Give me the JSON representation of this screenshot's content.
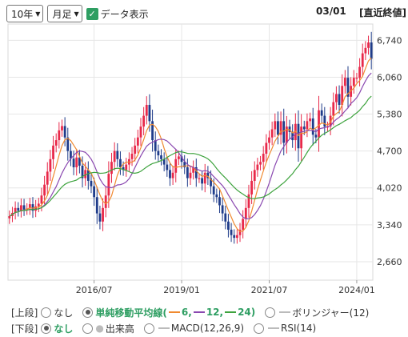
{
  "toolbar": {
    "period": "10年",
    "interval": "月足",
    "data_display_label": "データ表示",
    "date": "03/01",
    "close_label": "[直近終値]"
  },
  "controls": {
    "upper_label": "[上段]",
    "lower_label": "[下段]",
    "none": "なし",
    "sma_label": "単純移動平均線(",
    "sma_6": "6",
    "sma_12": "12",
    "sma_24": "24",
    "sma_close": ")",
    "bollinger": "ボリンジャー(12)",
    "volume": "出来高",
    "macd": "MACD(12,26,9)",
    "rsi": "RSI(14)"
  },
  "colors": {
    "up": "#e8294a",
    "down": "#1f3c8a",
    "ma6": "#f08a30",
    "ma12": "#8a48b0",
    "ma24": "#3ea33e",
    "accent": "#2e9e62"
  },
  "chart_data": {
    "type": "candlestick",
    "y_ticks": [
      "6,740",
      "6,060",
      "5,380",
      "4,700",
      "4,020",
      "3,340",
      "2,660"
    ],
    "y_tick_values": [
      6740,
      6060,
      5380,
      4700,
      4020,
      3340,
      2660
    ],
    "ylim": [
      2320,
      7040
    ],
    "x_ticks": [
      "2016/07",
      "2019/01",
      "2021/07",
      "2024/01"
    ],
    "x_tick_month_index": [
      29,
      59,
      89,
      119
    ],
    "start": "2014/02",
    "close": [
      3500,
      3560,
      3650,
      3600,
      3700,
      3620,
      3640,
      3720,
      3600,
      3680,
      3730,
      3880,
      4080,
      4320,
      4550,
      4800,
      4900,
      5080,
      5160,
      4950,
      4700,
      4560,
      4400,
      4580,
      4430,
      4200,
      4350,
      4150,
      4050,
      3850,
      3550,
      3400,
      3650,
      3880,
      4280,
      4500,
      4700,
      4550,
      4400,
      4350,
      4450,
      4550,
      4650,
      4800,
      4950,
      5150,
      5350,
      5550,
      5250,
      4900,
      4700,
      4620,
      4550,
      4450,
      4350,
      4200,
      4300,
      4550,
      4600,
      4500,
      4400,
      4200,
      4300,
      4400,
      4200,
      4200,
      4100,
      4300,
      4200,
      4050,
      3900,
      3850,
      3700,
      3550,
      3400,
      3250,
      3150,
      3100,
      3150,
      3250,
      3450,
      3650,
      3900,
      4150,
      4350,
      4450,
      4500,
      4650,
      4850,
      4950,
      5100,
      5250,
      5000,
      5250,
      4850,
      5150,
      5050,
      4900,
      5200,
      4750,
      5150,
      5100,
      5250,
      5300,
      5000,
      4950,
      5450,
      5350,
      5150,
      5150,
      5350,
      5600,
      5750,
      5550,
      5900,
      6050,
      5700,
      5900,
      6050,
      6050,
      6250,
      6500,
      6600,
      6700,
      6400
    ]
  }
}
